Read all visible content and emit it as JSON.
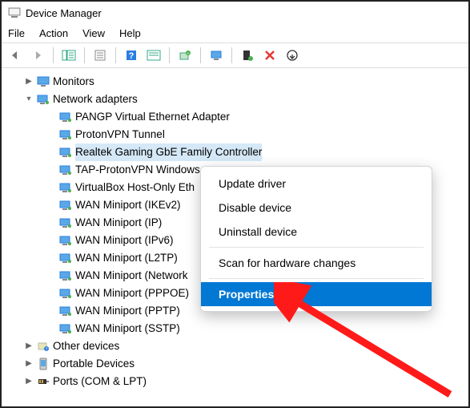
{
  "window": {
    "title": "Device Manager"
  },
  "menubar": [
    "File",
    "Action",
    "View",
    "Help"
  ],
  "tree": {
    "monitors": "Monitors",
    "network_adapters": "Network adapters",
    "adapters": [
      "PANGP Virtual Ethernet Adapter",
      "ProtonVPN Tunnel",
      "Realtek Gaming GbE Family Controller",
      "TAP-ProtonVPN Windows",
      "VirtualBox Host-Only Eth",
      "WAN Miniport (IKEv2)",
      "WAN Miniport (IP)",
      "WAN Miniport (IPv6)",
      "WAN Miniport (L2TP)",
      "WAN Miniport (Network",
      "WAN Miniport (PPPOE)",
      "WAN Miniport (PPTP)",
      "WAN Miniport (SSTP)"
    ],
    "other_devices": "Other devices",
    "portable_devices": "Portable Devices",
    "ports": "Ports (COM & LPT)"
  },
  "context_menu": {
    "update": "Update driver",
    "disable": "Disable device",
    "uninstall": "Uninstall device",
    "scan": "Scan for hardware changes",
    "properties": "Properties"
  }
}
